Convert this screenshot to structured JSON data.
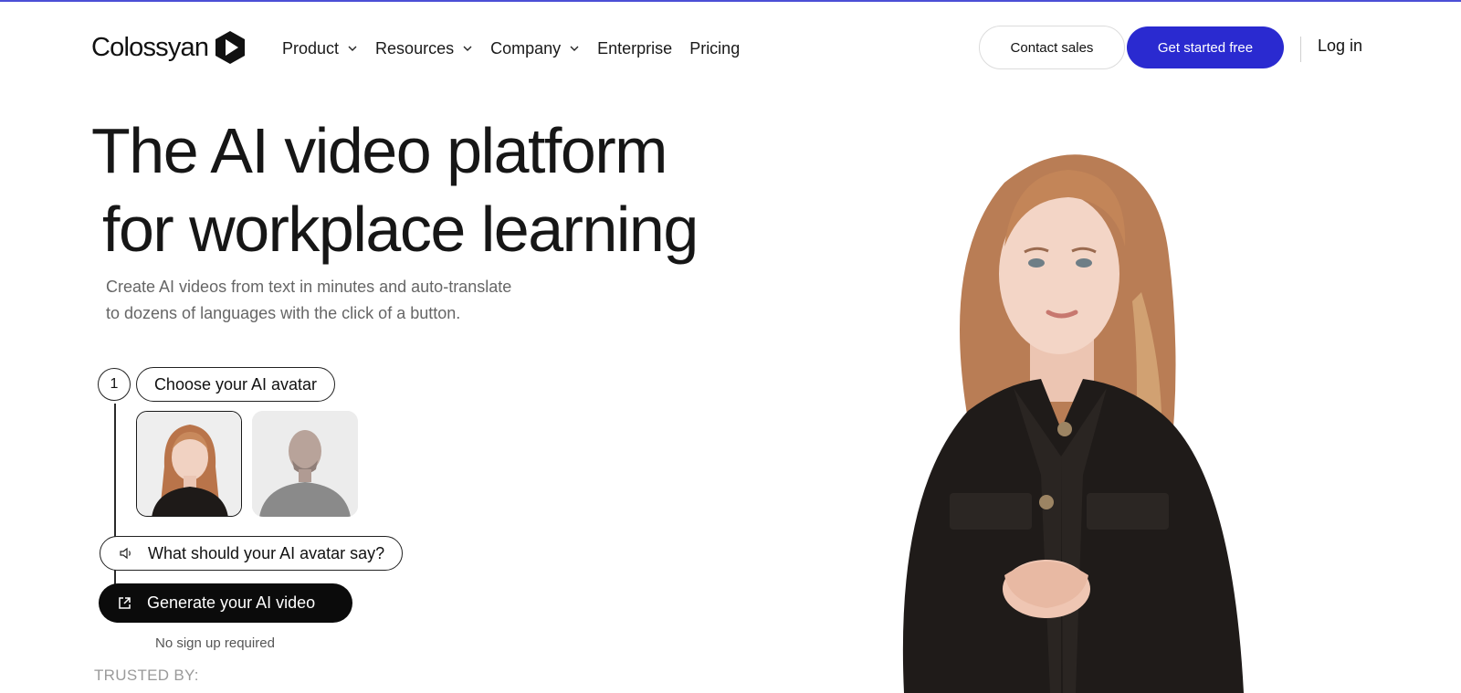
{
  "header": {
    "logo_text": "Colossyan",
    "nav": [
      {
        "label": "Product",
        "has_dropdown": true
      },
      {
        "label": "Resources",
        "has_dropdown": true
      },
      {
        "label": "Company",
        "has_dropdown": true
      },
      {
        "label": "Enterprise",
        "has_dropdown": false
      },
      {
        "label": "Pricing",
        "has_dropdown": false
      }
    ],
    "contact_sales": "Contact sales",
    "get_started": "Get started free",
    "login": "Log in"
  },
  "hero": {
    "title_line1": "The AI video platform",
    "title_line2": "for workplace learning",
    "subtitle_line1": "Create AI videos from text in minutes and auto-translate",
    "subtitle_line2": "to dozens of languages with the click of a button."
  },
  "steps": {
    "step_number": "1",
    "choose_label": "Choose your AI avatar",
    "say_placeholder": "What should your AI avatar say?",
    "generate_label": "Generate your AI video",
    "no_signup": "No sign up required"
  },
  "trusted_label": "TRUSTED BY:",
  "colors": {
    "accent": "#2a2ad0",
    "top_line": "#4b4fd6",
    "generate_button": "#0b0b0b"
  },
  "icons": [
    "logo-mark-icon",
    "chevron-down-icon",
    "speaker-icon",
    "external-link-icon"
  ]
}
